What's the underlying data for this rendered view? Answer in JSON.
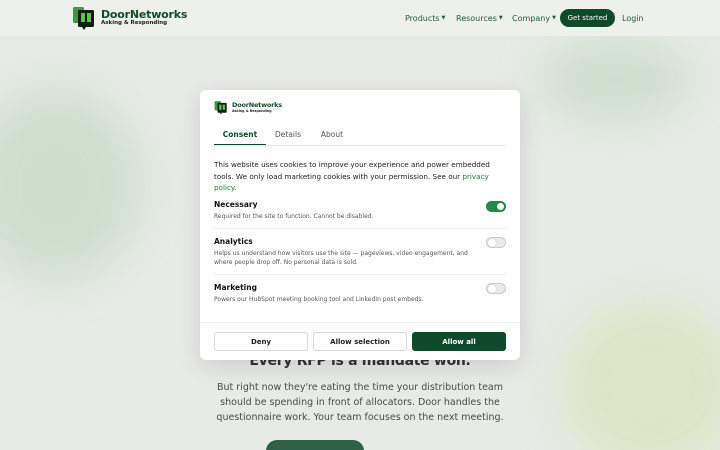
{
  "brand": {
    "name": "DoorNetworks",
    "tagline": "Asking & Responding"
  },
  "nav": {
    "items": [
      {
        "label": "Products"
      },
      {
        "label": "Resources"
      },
      {
        "label": "Company"
      }
    ],
    "cta_label": "Get started",
    "login_label": "Login"
  },
  "hero": {
    "title": "Every RFP is a mandate won.",
    "body": "But right now they're eating the time your distribution team should be spending in front of allocators. Door handles the questionnaire work. Your team focuses on the next meeting."
  },
  "consent": {
    "tabs": [
      {
        "label": "Consent",
        "active": true
      },
      {
        "label": "Details",
        "active": false
      },
      {
        "label": "About",
        "active": false
      }
    ],
    "intro_text": "This website uses cookies to improve your experience and power embedded tools. We only load marketing cookies with your permission. See our ",
    "privacy_link": "privacy policy",
    "intro_end": ".",
    "categories": [
      {
        "title": "Necessary",
        "desc": "Required for the site to function. Cannot be disabled.",
        "enabled": true
      },
      {
        "title": "Analytics",
        "desc": "Helps us understand how visitors use the site — pageviews, video engagement, and where people drop off. No personal data is sold.",
        "enabled": false
      },
      {
        "title": "Marketing",
        "desc": "Powers our HubSpot meeting booking tool and LinkedIn post embeds.",
        "enabled": false
      }
    ],
    "buttons": {
      "deny": "Deny",
      "allow_selection": "Allow selection",
      "allow_all": "Allow all"
    }
  },
  "colors": {
    "brand_dark": "#0f4a2b",
    "brand_green": "#1f8a45",
    "link": "#1a7a3c"
  },
  "icons": {
    "caret": "chevron-down-icon",
    "logo": "door-logo-icon"
  }
}
